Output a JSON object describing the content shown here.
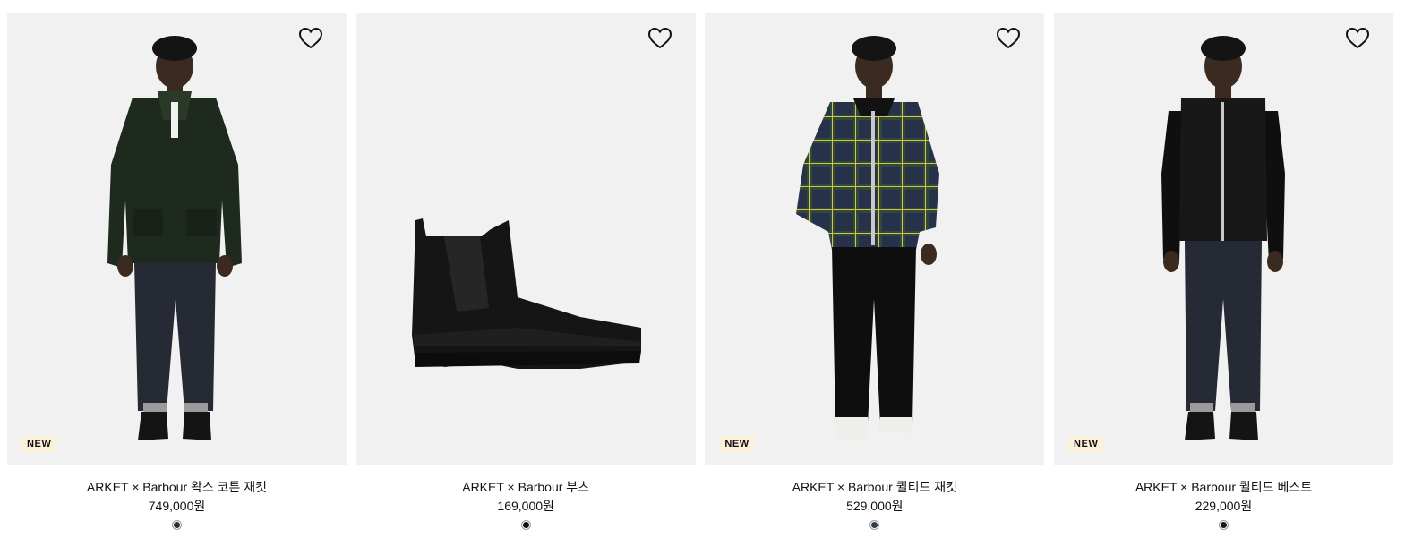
{
  "products": [
    {
      "name": "ARKET × Barbour 왁스 코튼 재킷",
      "price": "749,000원",
      "badge": "NEW",
      "image": "model-wax-cotton-jacket",
      "swatch_color": "#2e2e2e"
    },
    {
      "name": "ARKET × Barbour 부츠",
      "price": "169,000원",
      "badge": "",
      "image": "black-chelsea-rubber-boot",
      "swatch_color": "#111111"
    },
    {
      "name": "ARKET × Barbour 퀼티드 재킷",
      "price": "529,000원",
      "badge": "NEW",
      "image": "model-quilted-check-jacket",
      "swatch_color": "#2f3a4c"
    },
    {
      "name": "ARKET × Barbour 퀼티드 베스트",
      "price": "229,000원",
      "badge": "NEW",
      "image": "model-quilted-vest",
      "swatch_color": "#1a1a1a"
    }
  ],
  "icons": {
    "favorite": "heart-outline-icon"
  },
  "colors": {
    "image_background": "#f1f1f1",
    "badge_background": "#fbf0d8"
  }
}
